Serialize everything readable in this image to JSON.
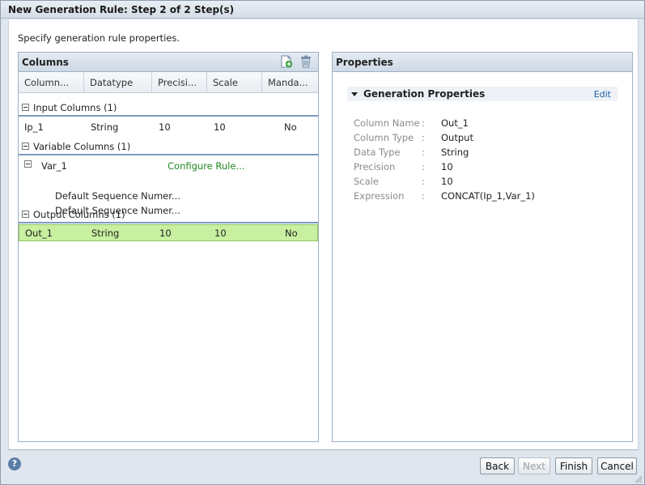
{
  "window": {
    "title": "New Generation Rule: Step 2 of 2 Step(s)"
  },
  "instructions": "Specify generation rule properties.",
  "columns_panel": {
    "title": "Columns",
    "headers": [
      "Column...",
      "Datatype",
      "Precisi...",
      "Scale",
      "Manda..."
    ],
    "groups": {
      "input": {
        "label": "Input Columns  (1)",
        "rows": [
          {
            "name": "Ip_1",
            "datatype": "String",
            "precision": "10",
            "scale": "10",
            "mandatory": "No"
          }
        ]
      },
      "variable": {
        "label": "Variable Columns  (1)",
        "item": {
          "name": "Var_1",
          "action": "Configure Rule...",
          "sub1": "Default Sequence Numer...",
          "sub2": "Default Sequence Numer..."
        }
      },
      "output": {
        "label": "Output Columns  (1)",
        "rows": [
          {
            "name": "Out_1",
            "datatype": "String",
            "precision": "10",
            "scale": "10",
            "mandatory": "No"
          }
        ]
      }
    }
  },
  "properties_panel": {
    "title": "Properties",
    "section_title": "Generation Properties",
    "edit_label": "Edit",
    "separator": ":",
    "props": [
      {
        "label": "Column Name",
        "value": "Out_1"
      },
      {
        "label": "Column Type",
        "value": "Output"
      },
      {
        "label": "Data Type",
        "value": "String"
      },
      {
        "label": "Precision",
        "value": "10"
      },
      {
        "label": "Scale",
        "value": "10"
      },
      {
        "label": "Expression",
        "value": "CONCAT(Ip_1,Var_1)"
      }
    ]
  },
  "footer": {
    "help": "?",
    "back": "Back",
    "next": "Next",
    "finish": "Finish",
    "cancel": "Cancel"
  },
  "icons": [
    "add-column-icon",
    "delete-icon",
    "help-icon",
    "collapse-icon",
    "resize-grip-icon"
  ]
}
